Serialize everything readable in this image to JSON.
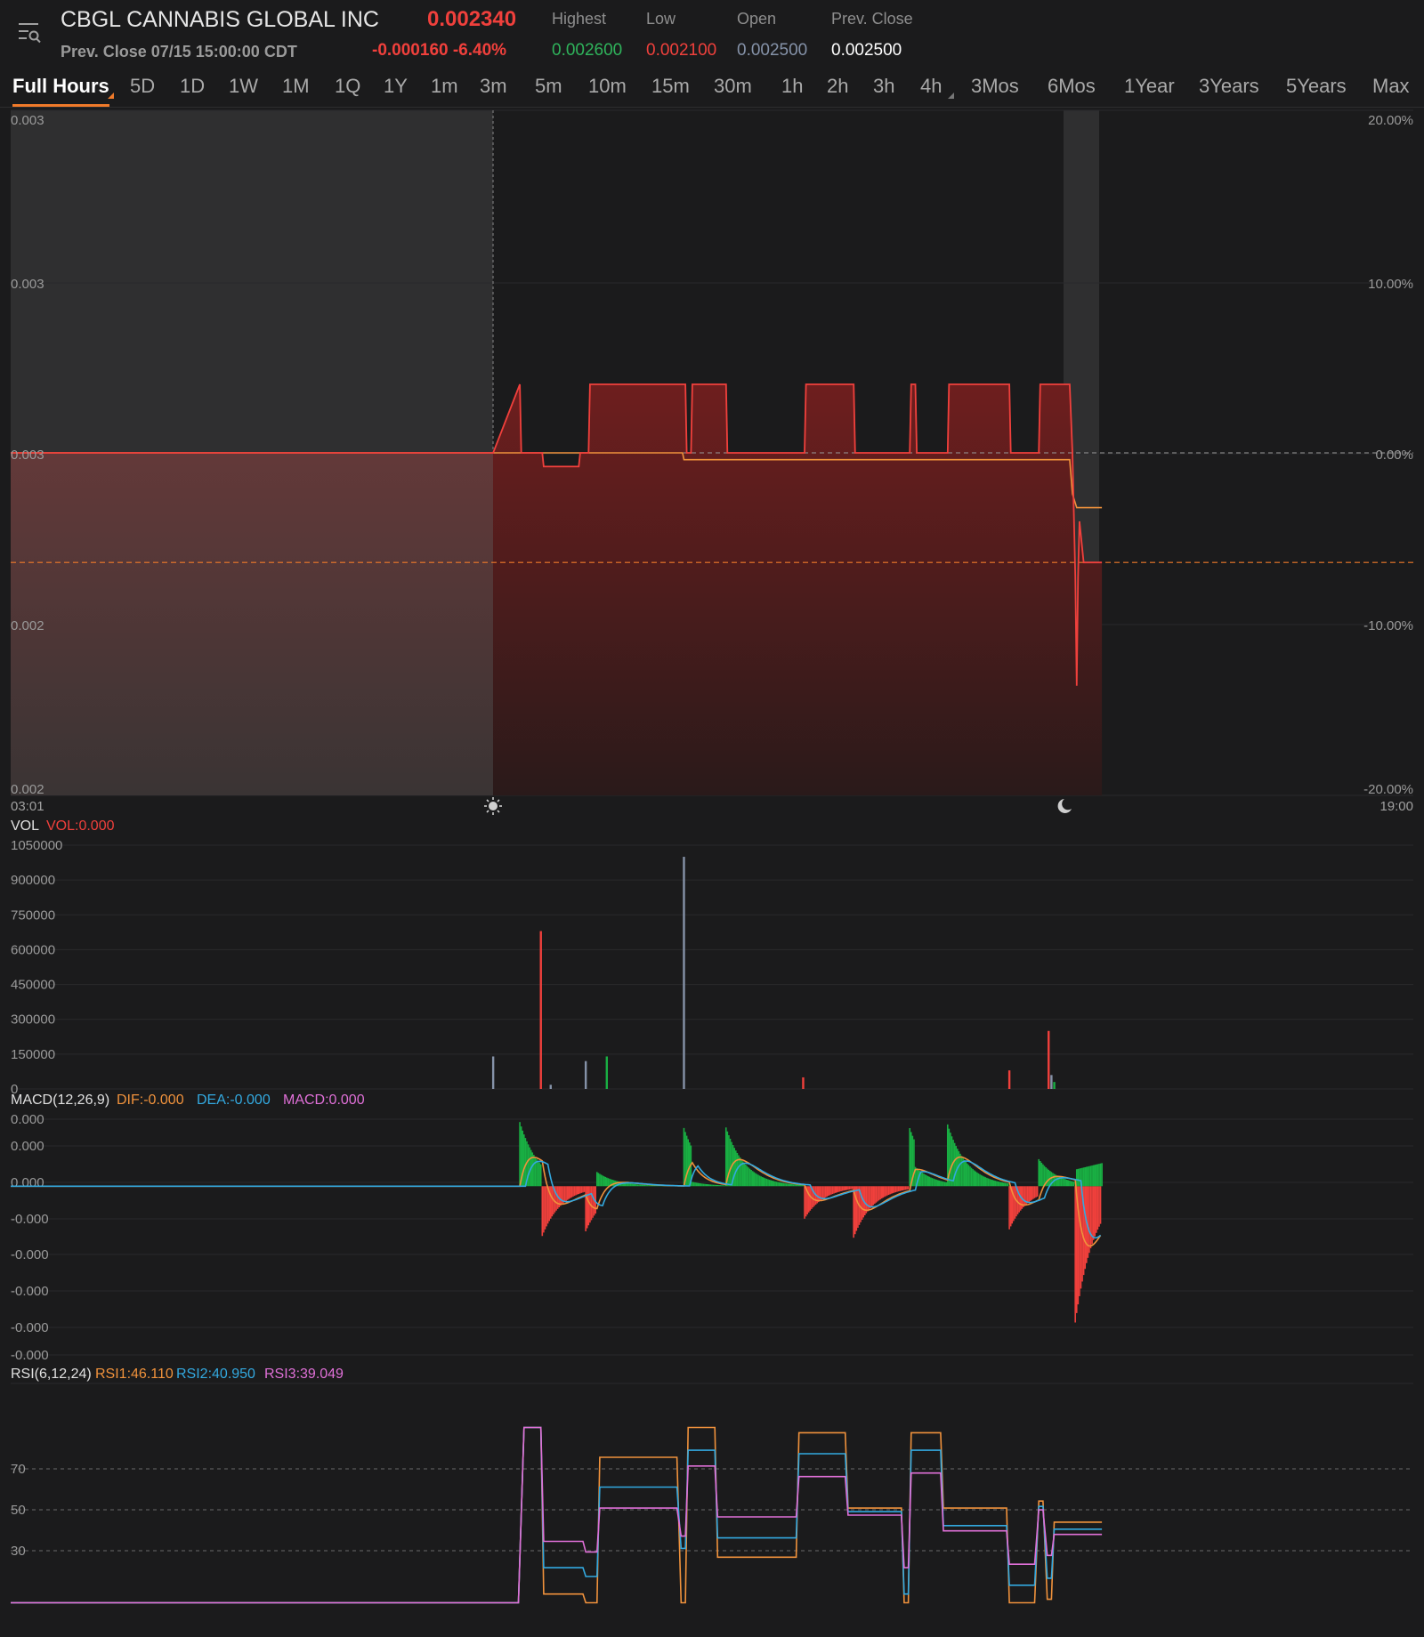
{
  "header": {
    "title": "CBGL CANNABIS GLOBAL INC",
    "price": "0.002340",
    "prev_close_time": "Prev. Close 07/15 15:00:00 CDT",
    "change": "-0.000160 -6.40%",
    "stats": [
      {
        "label": "Highest",
        "value": "0.002600",
        "color": "#2fb35b"
      },
      {
        "label": "Low",
        "value": "0.002100",
        "color": "#f0403c"
      },
      {
        "label": "Open",
        "value": "0.002500",
        "color": "#8592a8"
      },
      {
        "label": "Prev. Close",
        "value": "0.002500",
        "color": "#ffffff"
      }
    ]
  },
  "tabs": [
    "Full Hours",
    "5D",
    "1D",
    "1W",
    "1M",
    "1Q",
    "1Y",
    "1m",
    "3m",
    "5m",
    "10m",
    "15m",
    "30m",
    "1h",
    "2h",
    "3h",
    "4h",
    "3Mos",
    "6Mos",
    "1Year",
    "3Years",
    "5Years",
    "Max"
  ],
  "active_tab": "Full Hours",
  "colors": {
    "down": "#f0403c",
    "up": "#19b043",
    "avg": "#f0923c",
    "dea": "#33a9e0",
    "macd": "#e070d8",
    "neutral": "#8592a8"
  },
  "chart_data": [
    {
      "type": "area",
      "name": "price",
      "y_left_ticks": [
        "0.003",
        "0.003",
        "0.003",
        "0.002",
        "0.002"
      ],
      "y_right_ticks": [
        "20.00%",
        "10.00%",
        "0.00%",
        "-10.00%",
        "-20.00%"
      ],
      "x_labels": [
        "03:01",
        "19:00"
      ],
      "ylim": [
        0.002,
        0.003
      ],
      "prev_close": 0.0025,
      "current": 0.00234,
      "series": [
        {
          "type": "step",
          "x": [
            0,
            0.344,
            0.363,
            0.364,
            0.379,
            0.38,
            0.405,
            0.406,
            0.412,
            0.413,
            0.481,
            0.482,
            0.485,
            0.486,
            0.51,
            0.511,
            0.566,
            0.567,
            0.601,
            0.602,
            0.641,
            0.642,
            0.645,
            0.646,
            0.668,
            0.669,
            0.712,
            0.713,
            0.733,
            0.734,
            0.755,
            0.757,
            0.759,
            0.76,
            0.761,
            0.762,
            0.765,
            0.767,
            0.778
          ],
          "y": [
            0.0025,
            0.0025,
            0.0026,
            0.0025,
            0.0025,
            0.00248,
            0.00248,
            0.0025,
            0.0025,
            0.0026,
            0.0026,
            0.0025,
            0.0025,
            0.0026,
            0.0026,
            0.0025,
            0.0025,
            0.0026,
            0.0026,
            0.0025,
            0.0025,
            0.0026,
            0.0026,
            0.0025,
            0.0025,
            0.0026,
            0.0026,
            0.0025,
            0.0025,
            0.0026,
            0.0026,
            0.0025,
            0.00232,
            0.00216,
            0.00232,
            0.0024,
            0.00234,
            0.00234,
            0.00234
          ]
        },
        {
          "type": "avg",
          "x": [
            0,
            0.344,
            0.479,
            0.48,
            0.755,
            0.757,
            0.76,
            0.778
          ],
          "y": [
            0.0025,
            0.0025,
            0.0025,
            0.00249,
            0.00249,
            0.00244,
            0.00242,
            0.00242
          ]
        }
      ]
    },
    {
      "type": "bar",
      "name": "volume",
      "label": "VOL",
      "value_label": "VOL:0.000",
      "y_ticks": [
        "1050000",
        "900000",
        "750000",
        "600000",
        "450000",
        "300000",
        "150000",
        "0"
      ],
      "ylim": [
        0,
        1050000
      ],
      "bars": [
        {
          "x": 0.344,
          "v": 140000,
          "dir": "flat"
        },
        {
          "x": 0.378,
          "v": 680000,
          "dir": "down"
        },
        {
          "x": 0.385,
          "v": 18000,
          "dir": "flat"
        },
        {
          "x": 0.41,
          "v": 120000,
          "dir": "flat"
        },
        {
          "x": 0.425,
          "v": 140000,
          "dir": "up"
        },
        {
          "x": 0.48,
          "v": 1000000,
          "dir": "flat"
        },
        {
          "x": 0.565,
          "v": 50000,
          "dir": "down"
        },
        {
          "x": 0.712,
          "v": 80000,
          "dir": "down"
        },
        {
          "x": 0.74,
          "v": 250000,
          "dir": "down"
        },
        {
          "x": 0.742,
          "v": 60000,
          "dir": "flat"
        },
        {
          "x": 0.744,
          "v": 30000,
          "dir": "up"
        }
      ]
    },
    {
      "type": "line",
      "name": "macd",
      "label": "MACD(12,26,9)",
      "legend": [
        {
          "text": "DIF:-0.000",
          "color": "#f0923c"
        },
        {
          "text": "DEA:-0.000",
          "color": "#33a9e0"
        },
        {
          "text": "MACD:0.000",
          "color": "#e070d8"
        }
      ],
      "y_ticks": [
        "0.000",
        "0.000",
        "0.000",
        "-0.000",
        "-0.000",
        "-0.000",
        "-0.000",
        "-0.000"
      ],
      "ylim": [
        -5,
        2
      ]
    },
    {
      "type": "line",
      "name": "rsi",
      "label": "RSI(6,12,24)",
      "legend": [
        {
          "text": "RSI1:46.110",
          "color": "#f0923c"
        },
        {
          "text": "RSI2:40.950",
          "color": "#33a9e0"
        },
        {
          "text": "RSI3:39.049",
          "color": "#e070d8"
        }
      ],
      "y_ticks": [
        "70",
        "50",
        "30"
      ],
      "ylim": [
        0,
        100
      ],
      "series": [
        {
          "name": "RSI1",
          "x": [
            0,
            0.362,
            0.366,
            0.378,
            0.38,
            0.408,
            0.41,
            0.418,
            0.42,
            0.475,
            0.478,
            0.481,
            0.483,
            0.502,
            0.504,
            0.56,
            0.562,
            0.595,
            0.597,
            0.635,
            0.637,
            0.64,
            0.642,
            0.663,
            0.665,
            0.71,
            0.712,
            0.73,
            0.733,
            0.736,
            0.739,
            0.742,
            0.744,
            0.778
          ],
          "y": [
            0,
            0,
            100,
            100,
            5,
            5,
            0,
            0,
            83,
            83,
            0,
            0,
            100,
            100,
            26,
            26,
            97,
            97,
            54,
            54,
            0,
            0,
            97,
            97,
            54,
            54,
            0,
            0,
            58,
            58,
            2,
            2,
            46,
            46
          ]
        },
        {
          "name": "RSI2",
          "x": [
            0,
            0.362,
            0.366,
            0.378,
            0.38,
            0.408,
            0.41,
            0.418,
            0.42,
            0.475,
            0.478,
            0.481,
            0.483,
            0.502,
            0.504,
            0.56,
            0.562,
            0.595,
            0.597,
            0.635,
            0.637,
            0.64,
            0.642,
            0.663,
            0.665,
            0.71,
            0.712,
            0.73,
            0.733,
            0.736,
            0.739,
            0.742,
            0.744,
            0.778
          ],
          "y": [
            0,
            0,
            100,
            100,
            20,
            20,
            15,
            15,
            66,
            66,
            31,
            31,
            87,
            87,
            37,
            37,
            85,
            85,
            52,
            52,
            5,
            5,
            87,
            87,
            44,
            44,
            10,
            10,
            55,
            55,
            14,
            14,
            42,
            42
          ]
        },
        {
          "name": "RSI3",
          "x": [
            0,
            0.362,
            0.366,
            0.378,
            0.38,
            0.408,
            0.41,
            0.418,
            0.42,
            0.475,
            0.478,
            0.481,
            0.483,
            0.502,
            0.504,
            0.56,
            0.562,
            0.595,
            0.597,
            0.635,
            0.637,
            0.64,
            0.642,
            0.663,
            0.665,
            0.71,
            0.712,
            0.73,
            0.733,
            0.736,
            0.739,
            0.742,
            0.744,
            0.778
          ],
          "y": [
            0,
            0,
            100,
            100,
            35,
            35,
            29,
            29,
            54,
            54,
            38,
            38,
            78,
            78,
            49,
            49,
            72,
            72,
            50,
            50,
            20,
            20,
            74,
            74,
            41,
            41,
            22,
            22,
            53,
            53,
            27,
            27,
            39,
            39
          ]
        }
      ]
    }
  ]
}
